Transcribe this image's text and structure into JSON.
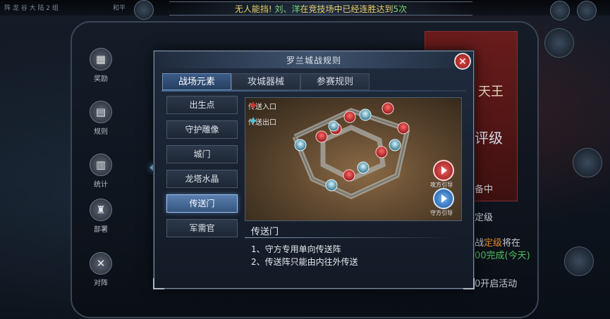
{
  "background": {
    "top_left_text": "阵 龙 谷 大 陆 2 组",
    "top_left_text2": "和平",
    "announcement": {
      "prefix": "无人能挡! ",
      "names": "刘、洋",
      "suffix": "在竞技场中已经连胜达到",
      "count": "5次"
    },
    "left_menu": [
      {
        "icon": "gift-icon",
        "glyph": "▦",
        "label": "奖励"
      },
      {
        "icon": "scroll-icon",
        "glyph": "▤",
        "label": "规则"
      },
      {
        "icon": "book-icon",
        "glyph": "▥",
        "label": "统计"
      },
      {
        "icon": "tower-icon",
        "glyph": "♜",
        "label": "部署"
      },
      {
        "icon": "crossed-swords-icon",
        "glyph": "✕",
        "label": "对阵"
      }
    ],
    "right_texts": {
      "king": "天王",
      "rank": "评级",
      "status": "备中",
      "level": "定级",
      "line1_prefix": "战",
      "line1_highlight": "定级",
      "line1_suffix": "将在",
      "line2": "00完成(今天)",
      "line3": "0开启活动"
    }
  },
  "dialog": {
    "title": "罗兰城战规则",
    "close_glyph": "✕",
    "tabs": [
      {
        "label": "战场元素",
        "active": true
      },
      {
        "label": "攻城器械",
        "active": false
      },
      {
        "label": "参赛规则",
        "active": false
      }
    ],
    "categories": [
      {
        "label": "出生点",
        "active": false
      },
      {
        "label": "守护雕像",
        "active": false
      },
      {
        "label": "城门",
        "active": false
      },
      {
        "label": "龙塔水晶",
        "active": false
      },
      {
        "label": "传送门",
        "active": true
      },
      {
        "label": "军需官",
        "active": false
      }
    ],
    "map": {
      "legend_entry": "传送入口",
      "legend_exit": "传送出口",
      "attack_guide": "攻方引导",
      "defend_guide": "守方引导"
    },
    "description": {
      "title": "传送门",
      "lines": [
        "1、守方专用单向传送阵",
        "2、传送阵只能由内往外传送"
      ]
    }
  },
  "colors": {
    "accent_blue": "#5a7fb0",
    "close_red": "#c62828",
    "announce_yellow": "#e8d06a",
    "announce_green": "#7fd67a",
    "entry_red": "#d32f2f",
    "exit_cyan": "#4fc3d8"
  }
}
